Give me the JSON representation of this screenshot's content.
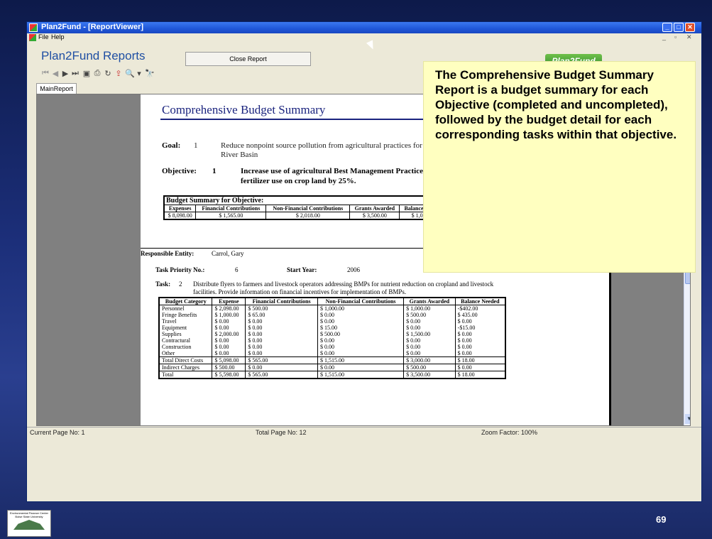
{
  "window": {
    "title": "Plan2Fund - [ReportViewer]"
  },
  "menu": {
    "file": "File",
    "help": "Help"
  },
  "header": {
    "app_title": "Plan2Fund Reports",
    "close_report": "Close Report",
    "logo_text": "Plan2Fund"
  },
  "tabs": {
    "main_report": "MainReport"
  },
  "report": {
    "title": "Comprehensive Budget Summary",
    "goal_label": "Goal:",
    "goal_num": "1",
    "goal_text": "Reduce nonpoint source pollution from agricultural practices for im",
    "goal_text2": "River Basin",
    "objective_label": "Objective:",
    "objective_num": "1",
    "objective_text": "Increase use of agricultural Best Management Practices fo",
    "objective_text2": "fertilizer use on crop land by 25%.",
    "summary": {
      "title": "Budget Summary for Objective:",
      "headers": [
        "Expenses",
        "Financial Contributions",
        "Non-Financial Contributions",
        "Grants Awarded",
        "Balance Needed"
      ],
      "values": [
        "$ 8,098.00",
        "$ 1,565.00",
        "$ 2,018.00",
        "$ 3,500.00",
        "$ 1,015.00"
      ]
    },
    "responsible_label": "Responsible Entity:",
    "responsible_value": "Carrol, Gary",
    "priority_label": "Task Priority No.:",
    "priority_value": "6",
    "start_label": "Start Year:",
    "start_value": "2006",
    "task_label": "Task:",
    "task_num": "2",
    "task_text": "Distribute flyers to farmers and livestock operators addressing BMPs for nutrient reduction on cropland and livestock",
    "task_text2": "facilities. Provide information on financial incentives for implementation of BMPs.",
    "detail": {
      "headers": [
        "Budget Category",
        "Expense",
        "Financial Contributions",
        "Non-Financial Contributions",
        "Grants Awarded",
        "Balance Needed"
      ],
      "rows": [
        [
          "Personnel",
          "$ 2,098.00",
          "$ 500.00",
          "$ 1,000.00",
          "$ 1,000.00",
          "-$402.00"
        ],
        [
          "Fringe Benefits",
          "$ 1,000.00",
          "$ 65.00",
          "$ 0.00",
          "$ 500.00",
          "$ 435.00"
        ],
        [
          "Travel",
          "$ 0.00",
          "$ 0.00",
          "$ 0.00",
          "$ 0.00",
          "$ 0.00"
        ],
        [
          "Equipment",
          "$ 0.00",
          "$ 0.00",
          "$ 15.00",
          "$ 0.00",
          "-$15.00"
        ],
        [
          "Supplies",
          "$ 2,000.00",
          "$ 0.00",
          "$ 500.00",
          "$ 1,500.00",
          "$ 0.00"
        ],
        [
          "Contractural",
          "$ 0.00",
          "$ 0.00",
          "$ 0.00",
          "$ 0.00",
          "$ 0.00"
        ],
        [
          "Construction",
          "$ 0.00",
          "$ 0.00",
          "$ 0.00",
          "$ 0.00",
          "$ 0.00"
        ],
        [
          "Other",
          "$ 0.00",
          "$ 0.00",
          "$ 0.00",
          "$ 0.00",
          "$ 0.00"
        ]
      ],
      "totals": [
        [
          "Total Direct Costs",
          "$ 5,098.00",
          "$ 565.00",
          "$ 1,515.00",
          "$ 3,000.00",
          "$ 18.00"
        ],
        [
          "Indirect Charges",
          "$ 500.00",
          "$ 0.00",
          "$ 0.00",
          "$ 500.00",
          "$ 0.00"
        ],
        [
          "Total",
          "$ 5,598.00",
          "$ 565.00",
          "$ 1,515.00",
          "$ 3,500.00",
          "$ 18.00"
        ]
      ]
    }
  },
  "callout": "The Comprehensive Budget Summary Report is a budget summary for each Objective (completed and uncompleted), followed by the budget detail for each corresponding tasks within that objective.",
  "status": {
    "current_page": "Current Page No: 1",
    "total_page": "Total Page No: 12",
    "zoom": "Zoom Factor: 100%"
  },
  "slide": {
    "page_number": "69",
    "footer_logo": "Environmental Finance Center Boise State University"
  }
}
